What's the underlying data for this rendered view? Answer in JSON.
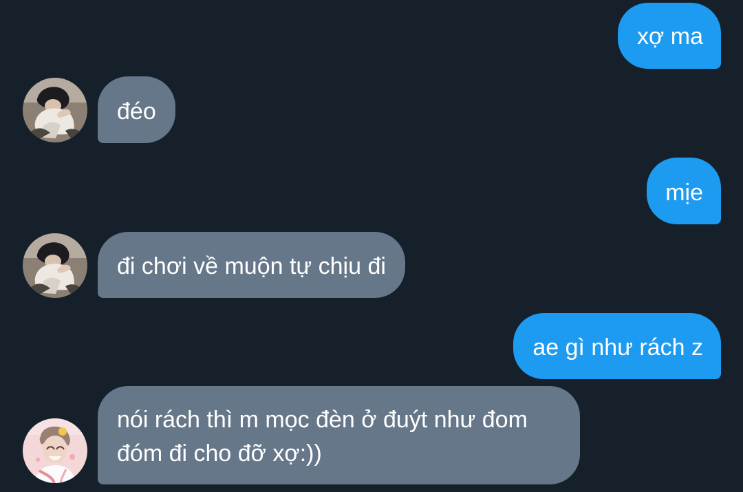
{
  "conversation": {
    "messages": [
      {
        "sender": "me",
        "text": "xợ ma"
      },
      {
        "sender": "other",
        "text": "đéo",
        "avatar_icon": "user-avatar-icon"
      },
      {
        "sender": "me",
        "text": "mịe"
      },
      {
        "sender": "other",
        "text": "đi chơi về muộn tự chịu đi",
        "avatar_icon": "user-avatar-icon"
      },
      {
        "sender": "me",
        "text": "ae gì như rách z"
      },
      {
        "sender": "other",
        "text": "nói rách thì m mọc đèn ở đuýt như đom đóm đi cho đỡ xợ:))",
        "avatar_icon": "user-avatar-icon"
      }
    ]
  },
  "colors": {
    "background": "#15202b",
    "sent_bubble": "#1d9bf0",
    "received_bubble": "#66778a",
    "text": "#ffffff"
  }
}
